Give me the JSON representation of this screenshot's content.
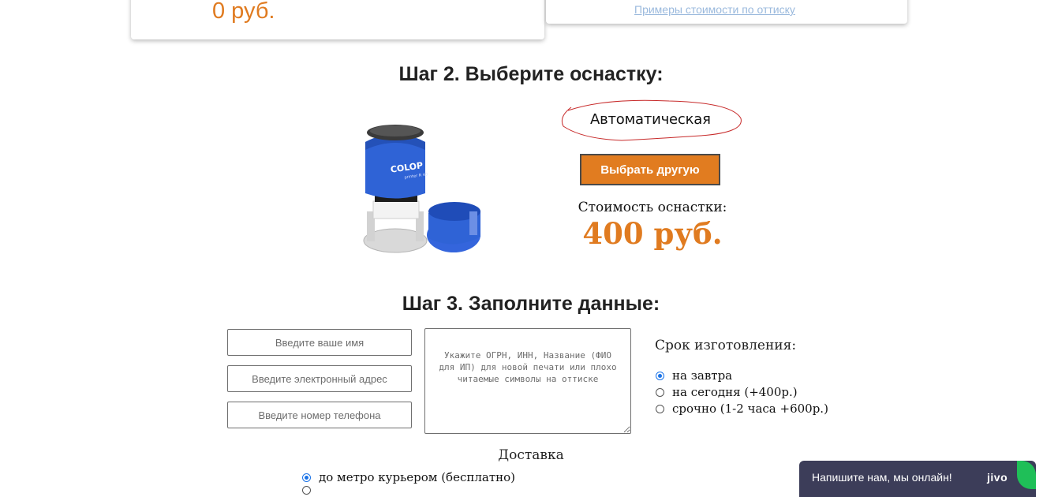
{
  "top_cards": {
    "left_price": "0 руб.",
    "examples_link": "Примеры стоимости по оттиску"
  },
  "step2": {
    "title": "Шаг 2. Выберите оснастку:",
    "rig_type": "Автоматическая",
    "choose_other_button": "Выбрать другую",
    "cost_label": "Стоимость оснастки:",
    "cost_value": "400 руб.",
    "stamp_brand": "COLOP"
  },
  "step3": {
    "title": "Шаг 3. Заполните данные:",
    "name_placeholder": "Введите ваше имя",
    "email_placeholder": "Введите электронный адрес",
    "phone_placeholder": "Введите номер телефона",
    "comment_placeholder": "Укажите ОГРН, ИНН, Название (ФИО для ИП) для новой печати или плохо читаемые символы на оттиске",
    "deadline": {
      "title": "Срок изготовления:",
      "options": [
        "на завтра",
        "на сегодня (+400р.)",
        "срочно (1-2 часа +600р.)"
      ],
      "selected": "на завтра"
    },
    "delivery": {
      "title": "Доставка",
      "options": [
        "до метро курьером (бесплатно)"
      ],
      "selected": "до метро курьером (бесплатно)"
    }
  },
  "chat": {
    "text": "Напишите нам, мы онлайн!",
    "logo": "jivo"
  },
  "colors": {
    "accent": "#e17c20",
    "price": "#e07b20",
    "chat_bg": "#3c3d59",
    "chat_green": "#1fbf58",
    "radio_selected": "#1a73e8"
  }
}
